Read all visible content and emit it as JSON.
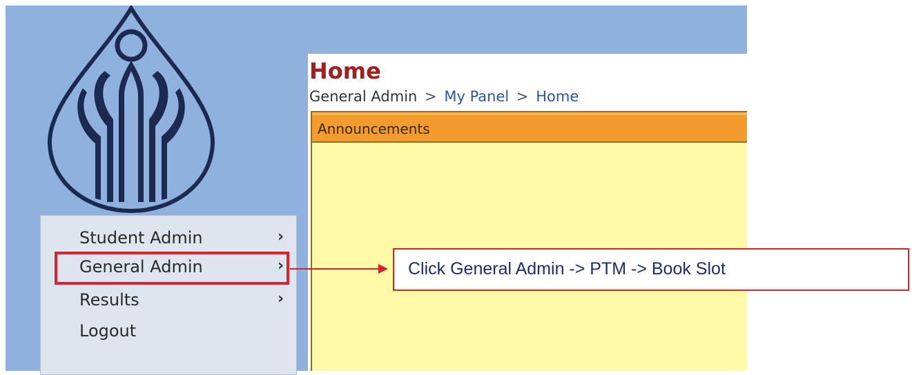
{
  "header": {
    "page_title": "Home",
    "breadcrumb": [
      {
        "label": "General Admin"
      },
      {
        "label": "My Panel"
      },
      {
        "label": "Home"
      }
    ],
    "separator": ">"
  },
  "announcements": {
    "title": "Announcements"
  },
  "menu": {
    "items": [
      {
        "label": "Student Admin",
        "arrow": "›"
      },
      {
        "label": "General Admin",
        "arrow": "›"
      },
      {
        "label": "Results",
        "arrow": "›"
      },
      {
        "label": "Logout",
        "arrow": ""
      }
    ]
  },
  "callout": {
    "text": "Click General Admin -> PTM -> Book Slot"
  },
  "colors": {
    "sidebar_bg": "#8fb1de",
    "title_red": "#a02020",
    "highlight_red": "#d8232a",
    "announcement_header": "#f39c2d",
    "announcement_body": "#fff9a8",
    "link_blue": "#2b56a8"
  },
  "icons": {
    "logo": "school-logo-drop-icon"
  }
}
